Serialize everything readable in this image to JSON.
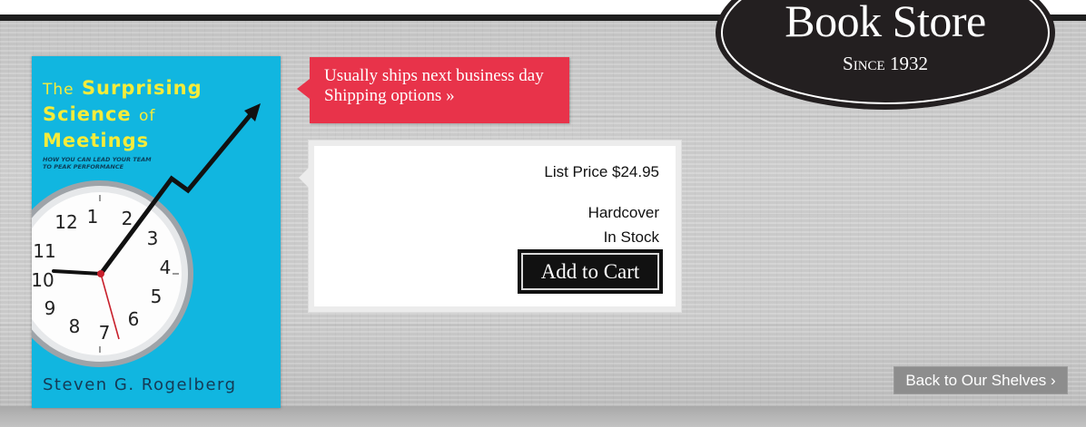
{
  "logo": {
    "title": "Book Store",
    "subtitle": "Since 1932"
  },
  "book": {
    "title_line1_lite": "The",
    "title_line1_bold": "Surprising",
    "title_line2_bold": "Science",
    "title_line2_lite": "of",
    "title_line3_bold": "Meetings",
    "subtitle_line1": "HOW YOU CAN LEAD YOUR TEAM",
    "subtitle_line2": "TO PEAK PERFORMANCE",
    "author": "Steven G. Rogelberg",
    "clock_numbers": [
      "12",
      "1",
      "2",
      "3",
      "4",
      "5",
      "6",
      "7",
      "8",
      "9",
      "10",
      "11"
    ]
  },
  "shipping": {
    "line1": "Usually ships next business day",
    "link": "Shipping options »"
  },
  "purchase": {
    "list_price": "List Price $24.95",
    "format": "Hardcover",
    "stock_status": "In Stock",
    "add_to_cart_label": "Add to Cart"
  },
  "navigation": {
    "back_label": "Back to Our Shelves ›"
  },
  "colors": {
    "book_cover": "#11b6e0",
    "book_title": "#f5ec3a",
    "shipping_banner": "#e8334a",
    "cart_button": "#111111",
    "back_button": "#8d8d8d",
    "logo_oval": "#231f20"
  }
}
